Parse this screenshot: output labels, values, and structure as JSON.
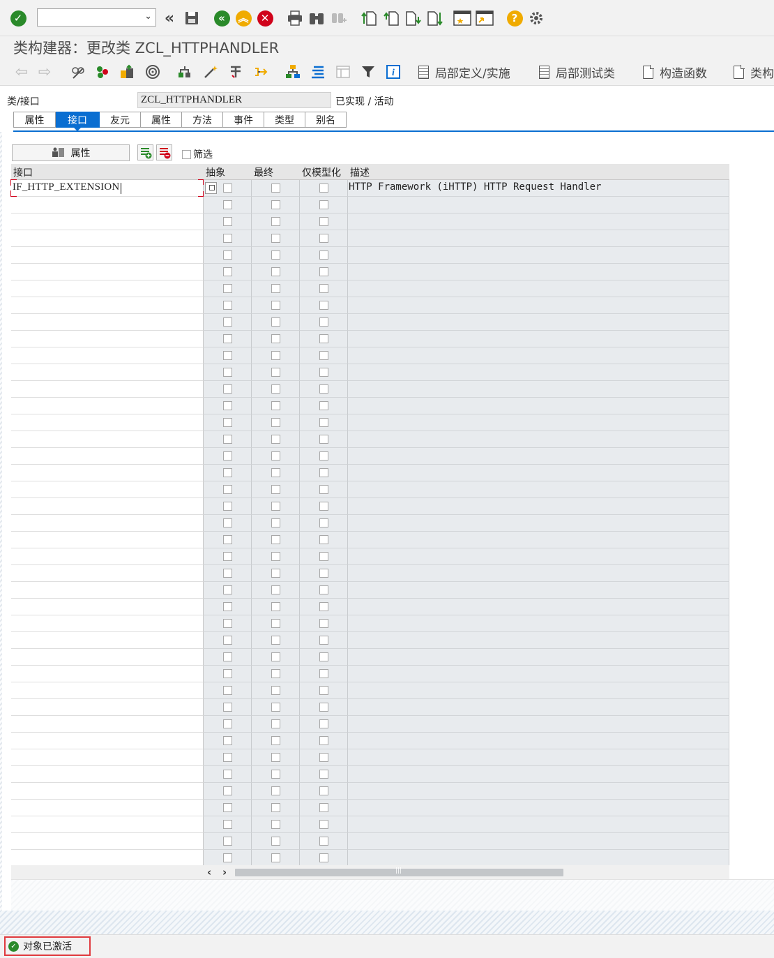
{
  "toolbar": {
    "icons": [
      "enter-icon",
      "command-dropdown",
      "back-double-icon",
      "save-icon",
      "back-icon",
      "exit-icon",
      "cancel-icon",
      "print-icon",
      "find-icon",
      "find-next-icon",
      "first-page-icon",
      "previous-page-icon",
      "next-page-icon",
      "last-page-icon",
      "new-session-icon",
      "shortcut-icon",
      "help-icon",
      "customize-icon"
    ]
  },
  "title": "类构建器：更改类 ZCL_HTTPHANDLER",
  "app_toolbar": {
    "buttons": [
      {
        "label": "局部定义/实施"
      },
      {
        "label": "局部测试类"
      },
      {
        "label": "构造函数"
      },
      {
        "label": "类构"
      }
    ]
  },
  "header": {
    "label": "类/接口",
    "value": "ZCL_HTTPHANDLER",
    "status": "已实现 / 活动"
  },
  "tabs": [
    {
      "label": "属性"
    },
    {
      "label": "接口",
      "active": true
    },
    {
      "label": "友元"
    },
    {
      "label": "属性"
    },
    {
      "label": "方法"
    },
    {
      "label": "事件"
    },
    {
      "label": "类型"
    },
    {
      "label": "别名"
    }
  ],
  "panel": {
    "attributes_button": "属性",
    "filter_label": "筛选"
  },
  "grid": {
    "columns": [
      "接口",
      "抽象",
      "最终",
      "仅模型化",
      "描述"
    ],
    "rows": [
      {
        "interface": "IF_HTTP_EXTENSION",
        "abstract": false,
        "final": false,
        "modeled_only": false,
        "description": "HTTP Framework (iHTTP) HTTP Request Handler"
      }
    ],
    "empty_rows": 40
  },
  "status_bar": {
    "message": "对象已激活"
  },
  "colors": {
    "accent": "#0a6ed1",
    "ok_green": "#2a8a2a",
    "warn_orange": "#f0ab00",
    "error_red": "#d0021b"
  }
}
